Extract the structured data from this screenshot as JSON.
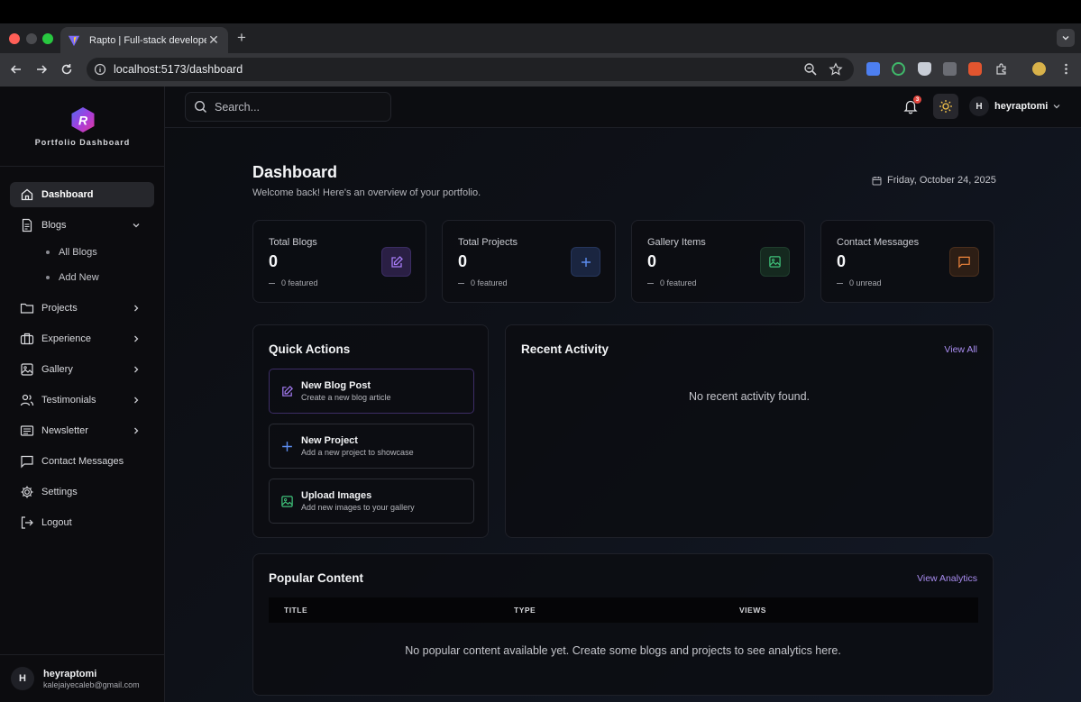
{
  "browser": {
    "tab_title": "Rapto | Full-stack developer",
    "url": "localhost:5173/dashboard"
  },
  "sidebar": {
    "logo_letter": "R",
    "logo_text": "Portfolio Dashboard",
    "items": [
      {
        "label": "Dashboard",
        "icon": "home-icon"
      },
      {
        "label": "Blogs",
        "icon": "file-text-icon"
      },
      {
        "label": "Projects",
        "icon": "folder-icon"
      },
      {
        "label": "Experience",
        "icon": "briefcase-icon"
      },
      {
        "label": "Gallery",
        "icon": "image-icon"
      },
      {
        "label": "Testimonials",
        "icon": "users-icon"
      },
      {
        "label": "Newsletter",
        "icon": "newspaper-icon"
      },
      {
        "label": "Contact Messages",
        "icon": "message-icon"
      },
      {
        "label": "Settings",
        "icon": "gear-icon"
      },
      {
        "label": "Logout",
        "icon": "logout-icon"
      }
    ],
    "blog_sub": [
      "All Blogs",
      "Add New"
    ],
    "user": {
      "initial": "H",
      "name": "heyraptomi",
      "email": "kalejaiyecaleb@gmail.com"
    }
  },
  "header": {
    "search_placeholder": "Search...",
    "notif_count": "3",
    "user_initial": "H",
    "user_name": "heyraptomi"
  },
  "page": {
    "title": "Dashboard",
    "subtitle": "Welcome back! Here's an overview of your portfolio.",
    "date": "Friday, October 24, 2025"
  },
  "stats": [
    {
      "label": "Total Blogs",
      "value": "0",
      "foot": "0 featured",
      "icon": "edit-icon",
      "color": "#a67cf6"
    },
    {
      "label": "Total Projects",
      "value": "0",
      "foot": "0 featured",
      "icon": "plus-icon",
      "color": "#5d8df0"
    },
    {
      "label": "Gallery Items",
      "value": "0",
      "foot": "0 featured",
      "icon": "image-icon",
      "color": "#3fc27a"
    },
    {
      "label": "Contact Messages",
      "value": "0",
      "foot": "0 unread",
      "icon": "message-icon",
      "color": "#f0863c"
    }
  ],
  "quick_actions": {
    "title": "Quick Actions",
    "items": [
      {
        "title": "New Blog Post",
        "sub": "Create a new blog article",
        "icon": "edit-icon"
      },
      {
        "title": "New Project",
        "sub": "Add a new project to showcase",
        "icon": "plus-icon"
      },
      {
        "title": "Upload Images",
        "sub": "Add new images to your gallery",
        "icon": "image-icon"
      }
    ]
  },
  "recent_activity": {
    "title": "Recent Activity",
    "link": "View All",
    "empty": "No recent activity found."
  },
  "popular": {
    "title": "Popular Content",
    "link": "View Analytics",
    "columns": [
      "TITLE",
      "TYPE",
      "VIEWS"
    ],
    "empty": "No popular content available yet. Create some blogs and projects to see analytics here."
  }
}
